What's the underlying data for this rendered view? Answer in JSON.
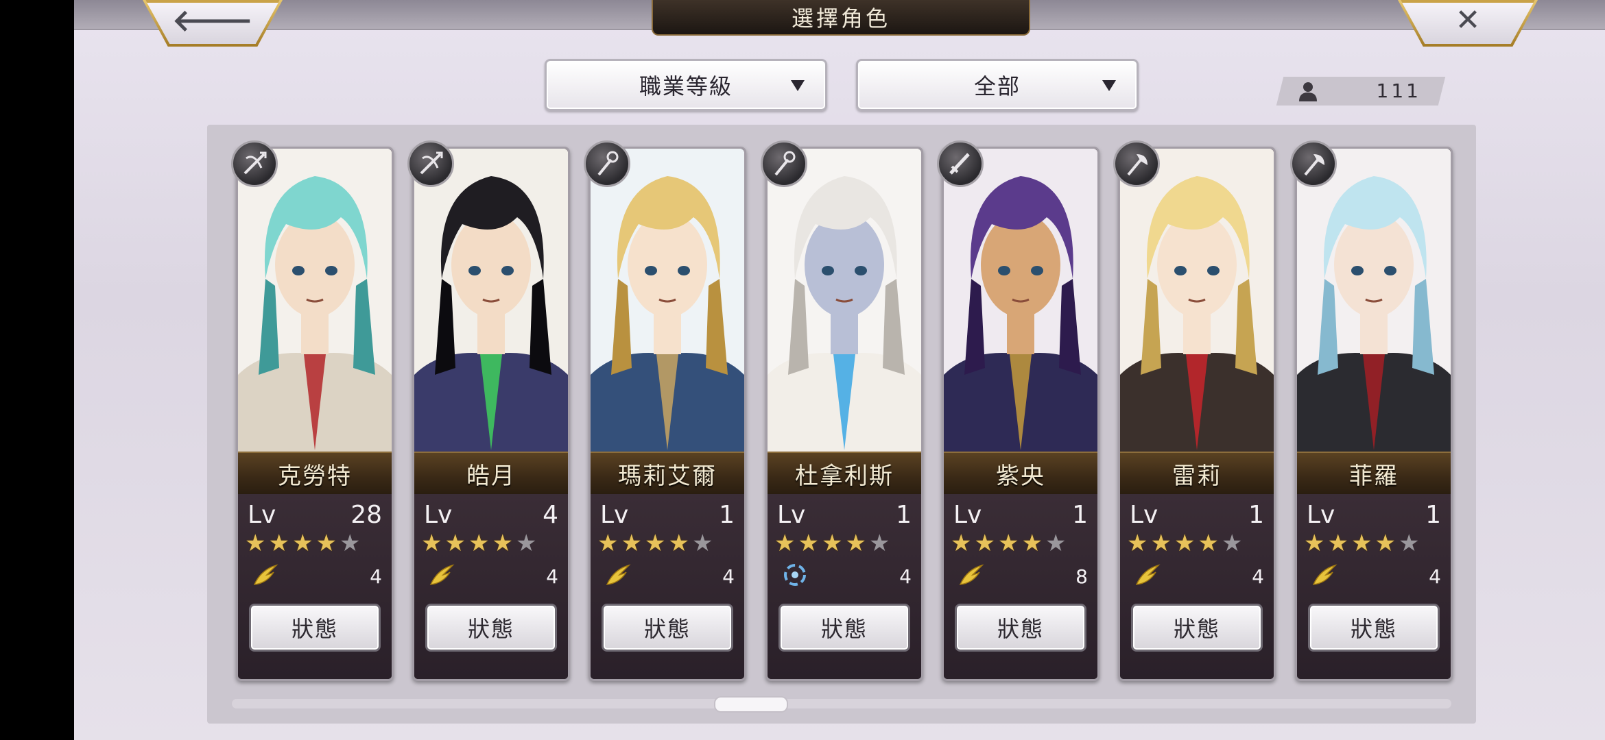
{
  "header": {
    "title": "選擇角色",
    "back_icon": "arrow-left-icon",
    "close_icon": "close-icon",
    "back_glyph": "🡐",
    "close_glyph": "✕"
  },
  "filters": {
    "sort": {
      "label": "職業等級",
      "icon": "chevron-down-icon"
    },
    "category": {
      "label": "全部",
      "icon": "chevron-down-icon"
    }
  },
  "roster_count": {
    "icon": "person-icon",
    "value": "111"
  },
  "labels": {
    "lv": "Lv",
    "status_button": "狀態"
  },
  "colors": {
    "star_filled": "#e7c25a",
    "star_empty": "#9a979c",
    "name_bar": "#3a2916"
  },
  "characters": [
    {
      "name": "克勞特",
      "level": "28",
      "stars_filled": 4,
      "stars_total": 5,
      "element_icon": "wind-feather-icon",
      "rank": "4",
      "class_icon": "crossbow-icon"
    },
    {
      "name": "皓月",
      "level": "4",
      "stars_filled": 4,
      "stars_total": 5,
      "element_icon": "wind-feather-icon",
      "rank": "4",
      "class_icon": "crossbow-icon"
    },
    {
      "name": "瑪莉艾爾",
      "level": "1",
      "stars_filled": 4,
      "stars_total": 5,
      "element_icon": "wind-feather-icon",
      "rank": "4",
      "class_icon": "staff-icon"
    },
    {
      "name": "杜拿利斯",
      "level": "1",
      "stars_filled": 4,
      "stars_total": 5,
      "element_icon": "water-swirl-icon",
      "rank": "4",
      "class_icon": "staff-icon"
    },
    {
      "name": "紫央",
      "level": "1",
      "stars_filled": 4,
      "stars_total": 5,
      "element_icon": "wind-feather-icon",
      "rank": "8",
      "class_icon": "sword-icon"
    },
    {
      "name": "雷莉",
      "level": "1",
      "stars_filled": 4,
      "stars_total": 5,
      "element_icon": "wind-feather-icon",
      "rank": "4",
      "class_icon": "axe-icon"
    },
    {
      "name": "菲羅",
      "level": "1",
      "stars_filled": 4,
      "stars_total": 5,
      "element_icon": "wind-feather-icon",
      "rank": "4",
      "class_icon": "axe-icon"
    }
  ],
  "portraits": [
    {
      "hair": "#7fd6cf",
      "hair_dark": "#3f9a98",
      "skin": "#f3ddc8",
      "outfit": "#dcd3c4",
      "accent": "#b3262a",
      "bg": "#f4f1ec"
    },
    {
      "hair": "#1f1d22",
      "hair_dark": "#0c0b0f",
      "skin": "#f3dcc6",
      "outfit": "#3a3b6a",
      "accent": "#3fcf5d",
      "bg": "#f2efe9"
    },
    {
      "hair": "#e6c777",
      "hair_dark": "#b9913f",
      "skin": "#f6e1cc",
      "outfit": "#34507a",
      "accent": "#c9a562",
      "bg": "#eef3f6"
    },
    {
      "hair": "#e9e6e2",
      "hair_dark": "#b9b4ad",
      "skin": "#b8bfd6",
      "outfit": "#f2eee8",
      "accent": "#3aa6e4",
      "bg": "#f6f4f2"
    },
    {
      "hair": "#5b3b8c",
      "hair_dark": "#2d1b4d",
      "skin": "#d8a676",
      "outfit": "#2e2a55",
      "accent": "#c39a3c",
      "bg": "#efeaf0"
    },
    {
      "hair": "#f0d88f",
      "hair_dark": "#c6a452",
      "skin": "#f6e2cf",
      "outfit": "#3b302c",
      "accent": "#c8242b",
      "bg": "#f4efe9"
    },
    {
      "hair": "#bfe4ef",
      "hair_dark": "#86b9cf",
      "skin": "#f4e2d4",
      "outfit": "#2b2b30",
      "accent": "#a31e25",
      "bg": "#f3f0f1"
    }
  ],
  "scroll": {
    "position": 0.1
  }
}
